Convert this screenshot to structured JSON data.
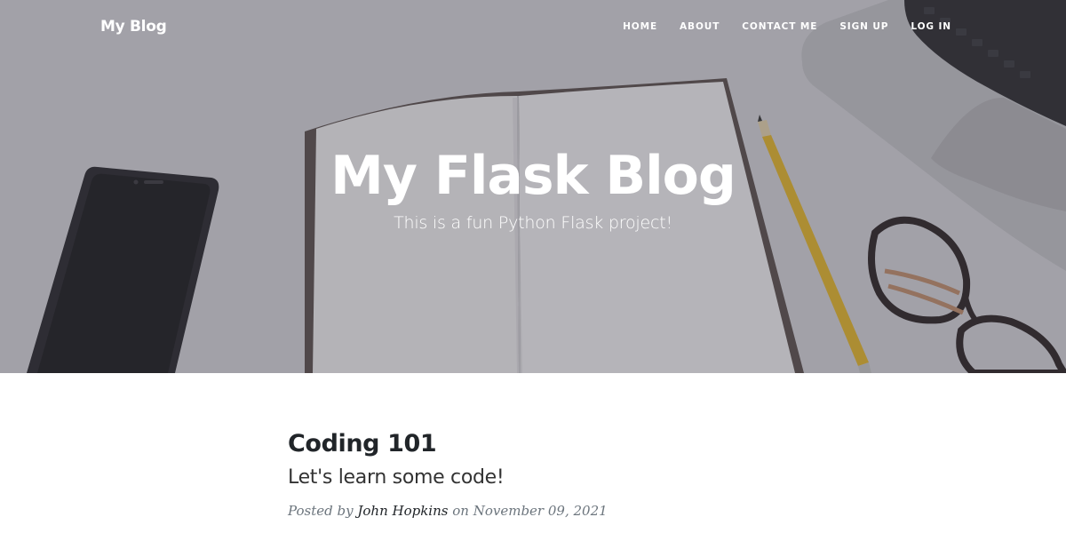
{
  "navbar": {
    "brand": "My Blog",
    "links": [
      "HOME",
      "ABOUT",
      "CONTACT ME",
      "SIGN UP",
      "LOG IN"
    ]
  },
  "hero": {
    "title": "My Flask Blog",
    "subtitle": "This is a fun Python Flask project!",
    "background_image_subjects": [
      "smartphone-icon",
      "notebook-icon",
      "pencil-icon",
      "glasses-icon",
      "laptop-icon"
    ]
  },
  "post": {
    "title": "Coding 101",
    "subtitle": "Let's learn some code!",
    "meta_posted_by": "Posted by",
    "author": "John Hopkins",
    "meta_on": "on",
    "date": "November 09, 2021"
  },
  "colors": {
    "hero_tint": "#7e7d84",
    "text_dark": "#212529",
    "text_muted": "#6c757d",
    "white": "#ffffff"
  }
}
